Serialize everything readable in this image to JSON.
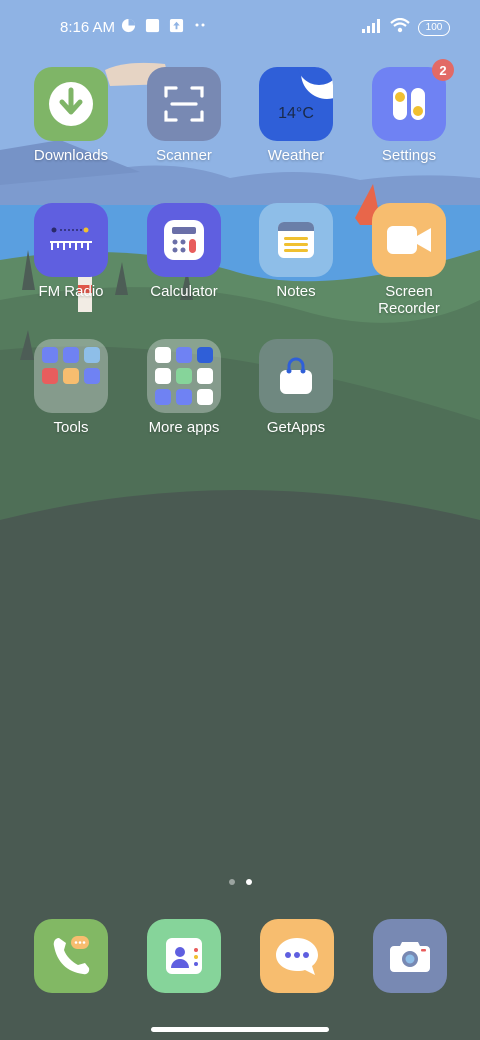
{
  "status_bar": {
    "time": "8:16 AM",
    "icons_left": [
      "data-saver-icon",
      "square-notification-icon",
      "upload-notification-icon",
      "more-notifications-icon"
    ],
    "icons_right": [
      "signal-icon",
      "wifi-icon",
      "battery-icon"
    ],
    "battery": "100"
  },
  "home": {
    "apps": [
      {
        "label": "Downloads",
        "icon": "download-icon",
        "color": "#7fb567"
      },
      {
        "label": "Scanner",
        "icon": "scanner-icon",
        "color": "#7889b3"
      },
      {
        "label": "Weather",
        "icon": "weather-icon",
        "color": "#2f5fd8",
        "text": "14°C"
      },
      {
        "label": "Settings",
        "icon": "settings-icon",
        "color": "#6f82f3",
        "badge": "2"
      },
      {
        "label": "FM Radio",
        "icon": "radio-icon",
        "color": "#5f5fe0"
      },
      {
        "label": "Calculator",
        "icon": "calculator-icon",
        "color": "#5f5fe0"
      },
      {
        "label": "Notes",
        "icon": "notes-icon",
        "color": "#8ebee8"
      },
      {
        "label": "Screen Recorder",
        "icon": "video-camera-icon",
        "color": "#f7bd6f"
      },
      {
        "label": "Tools",
        "icon": "folder-icon"
      },
      {
        "label": "More apps",
        "icon": "folder-icon"
      },
      {
        "label": "GetApps",
        "icon": "shopping-bag-icon",
        "color": "#6f8880"
      }
    ]
  },
  "pagination": {
    "pages": 2,
    "current": 2
  },
  "dock": [
    {
      "name": "phone",
      "icon": "phone-icon",
      "color": "#82b864"
    },
    {
      "name": "contacts",
      "icon": "contacts-icon",
      "color": "#86d49a"
    },
    {
      "name": "messages",
      "icon": "message-icon",
      "color": "#f7bd6f"
    },
    {
      "name": "camera",
      "icon": "camera-icon",
      "color": "#7889b3"
    }
  ]
}
